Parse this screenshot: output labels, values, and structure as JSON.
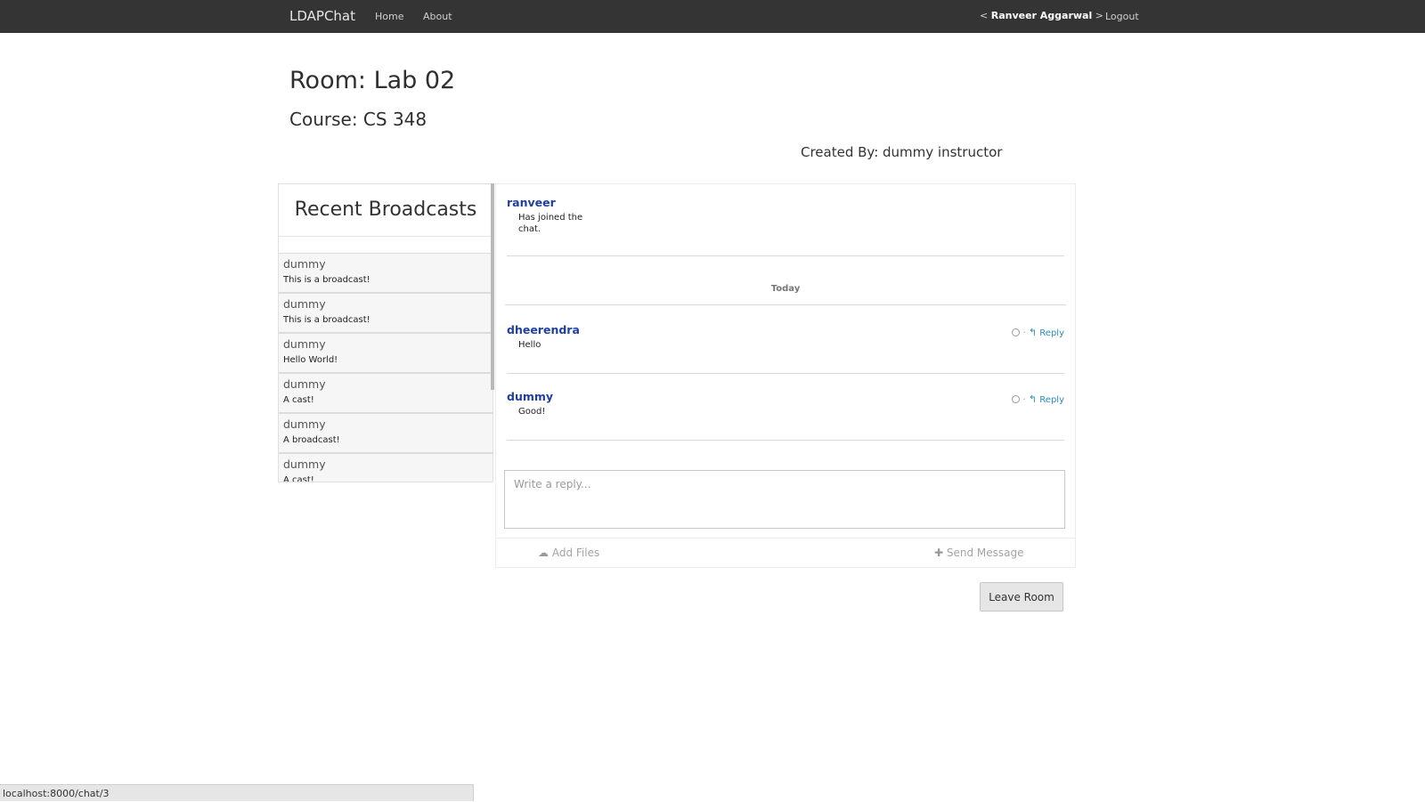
{
  "navbar": {
    "brand": "LDAPChat",
    "links": [
      "Home",
      "About"
    ],
    "user_prefix": "<",
    "user_name": "Ranveer Aggarwal",
    "user_suffix": ">",
    "logout": "Logout",
    "background": "#343434"
  },
  "room": {
    "title": "Room: Lab 02",
    "course": "Course: CS 348",
    "created_by": "Created By: dummy instructor"
  },
  "broadcasts": {
    "header": "Recent Broadcasts",
    "items": [
      {
        "author": "dummy",
        "text": "This is a broadcast!"
      },
      {
        "author": "dummy",
        "text": "This is a broadcast!"
      },
      {
        "author": "dummy",
        "text": "Hello World!"
      },
      {
        "author": "dummy",
        "text": "A cast!"
      },
      {
        "author": "dummy",
        "text": "A broadcast!"
      },
      {
        "author": "dummy",
        "text": "A cast!"
      }
    ]
  },
  "chat": {
    "messages": [
      {
        "author": "ranveer",
        "body": "Has joined the chat.",
        "has_actions": false
      },
      {
        "author": "dheerendra",
        "body": "Hello",
        "has_actions": true
      },
      {
        "author": "dummy",
        "body": "Good!",
        "has_actions": true
      }
    ],
    "day_divider": "Today",
    "separator": "·",
    "reply_label": "Reply",
    "reply_placeholder": "Write a reply...",
    "add_files": "Add Files",
    "send_message": "Send Message",
    "author_color": "#1f3fa3",
    "link_color": "#2a8ab8"
  },
  "actions": {
    "leave_room": "Leave Room"
  },
  "status_bar": {
    "url": "localhost:8000/chat/3"
  }
}
